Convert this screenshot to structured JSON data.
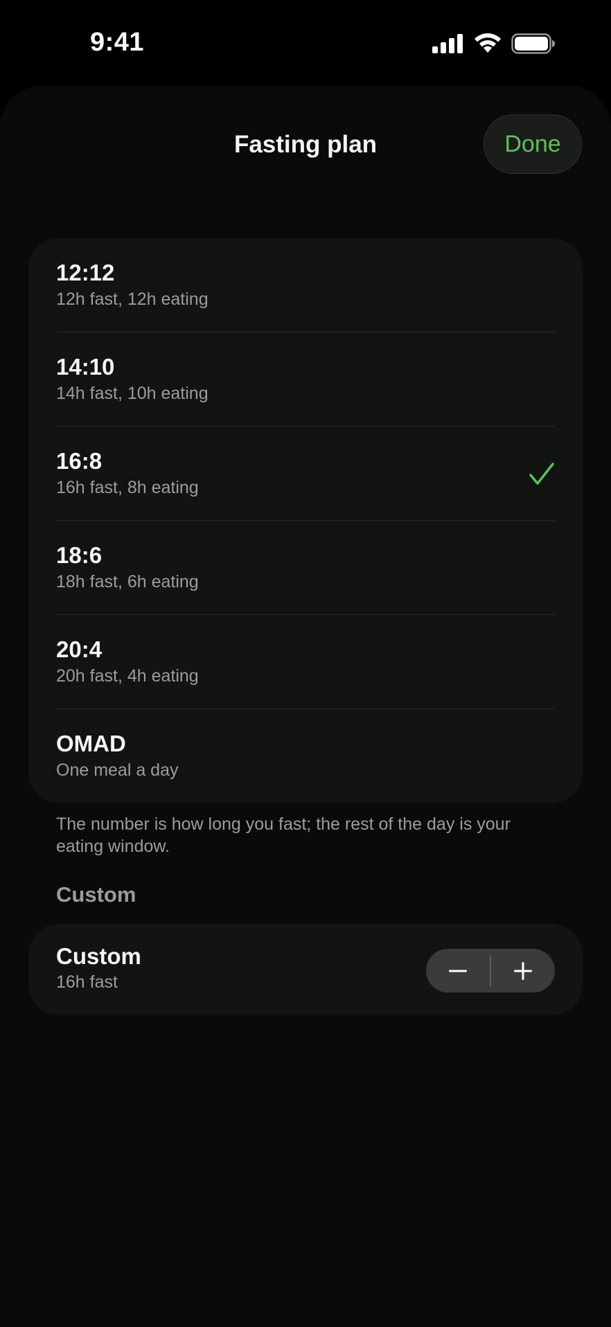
{
  "status_bar": {
    "time": "9:41",
    "icons": [
      "cellular-signal-icon",
      "wifi-icon",
      "battery-icon"
    ]
  },
  "header": {
    "title": "Fasting plan",
    "done_label": "Done"
  },
  "plans": [
    {
      "name": "12:12",
      "desc": "12h fast, 12h eating",
      "selected": false
    },
    {
      "name": "14:10",
      "desc": "14h fast, 10h eating",
      "selected": false
    },
    {
      "name": "16:8",
      "desc": "16h fast, 8h eating",
      "selected": true
    },
    {
      "name": "18:6",
      "desc": "18h fast, 6h eating",
      "selected": false
    },
    {
      "name": "20:4",
      "desc": "20h fast, 4h eating",
      "selected": false
    },
    {
      "name": "OMAD",
      "desc": "One meal a day",
      "selected": false
    }
  ],
  "footer_note": "The number is how long you fast; the rest of the day is your eating window.",
  "custom_section": {
    "header": "Custom",
    "name": "Custom",
    "desc": "16h fast",
    "decrement_icon": "minus-icon",
    "increment_icon": "plus-icon"
  },
  "colors": {
    "accent": "#5fbf5f",
    "background": "#000000",
    "sheet": "#090b09",
    "card": "#111411",
    "secondary_text": "#9a9e9a"
  }
}
